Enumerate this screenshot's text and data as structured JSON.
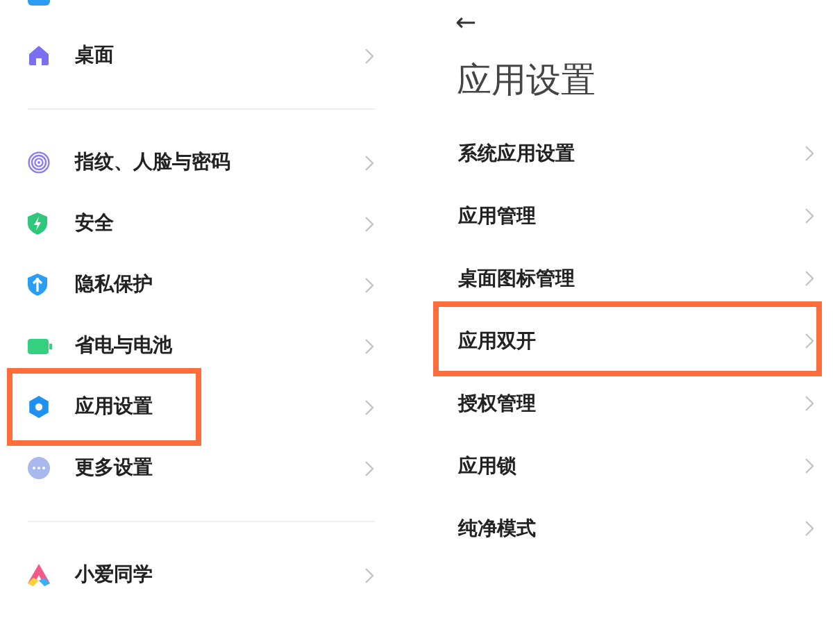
{
  "left_screen": {
    "groups": [
      {
        "items": [
          {
            "label": "桌面",
            "highlighted": false
          }
        ]
      },
      {
        "items": [
          {
            "label": "指纹、人脸与密码",
            "highlighted": false
          },
          {
            "label": "安全",
            "highlighted": false
          },
          {
            "label": "隐私保护",
            "highlighted": false
          },
          {
            "label": "省电与电池",
            "highlighted": false
          },
          {
            "label": "应用设置",
            "highlighted": true
          },
          {
            "label": "更多设置",
            "highlighted": false
          }
        ]
      },
      {
        "items": [
          {
            "label": "小爱同学",
            "highlighted": false
          }
        ]
      }
    ]
  },
  "right_screen": {
    "back": "←",
    "title": "应用设置",
    "items": [
      {
        "label": "系统应用设置",
        "highlighted": false
      },
      {
        "label": "应用管理",
        "highlighted": false
      },
      {
        "label": "桌面图标管理",
        "highlighted": false
      },
      {
        "label": "应用双开",
        "highlighted": true
      },
      {
        "label": "授权管理",
        "highlighted": false
      },
      {
        "label": "应用锁",
        "highlighted": false
      },
      {
        "label": "纯净模式",
        "highlighted": false
      }
    ]
  }
}
